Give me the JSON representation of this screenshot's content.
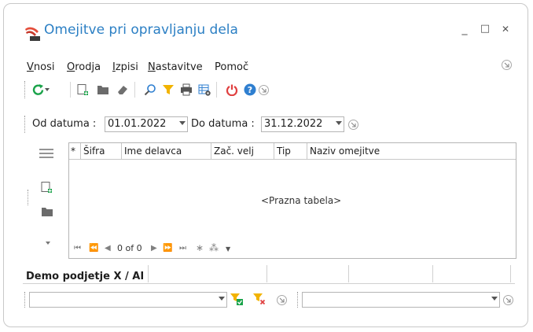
{
  "window": {
    "title": "Omejitve pri opravljanju dela",
    "controls": {
      "minimize": "_",
      "maximize": "□",
      "close": "✕"
    }
  },
  "menu": {
    "items": [
      {
        "label": "Vnosi",
        "accel": "V",
        "rest": "nosi"
      },
      {
        "label": "Orodja",
        "accel": "O",
        "rest": "rodja"
      },
      {
        "label": "Izpisi",
        "accel": "I",
        "rest": "zpisi"
      },
      {
        "label": "Nastavitve",
        "accel": "N",
        "rest": "astavitve"
      },
      {
        "label": "Pomoč",
        "accel": "",
        "rest": "Pomoč"
      }
    ]
  },
  "toolbar": {
    "icons": [
      "refresh-icon",
      "new-document-icon",
      "folder-icon",
      "eraser-icon",
      "search-icon",
      "filter-icon",
      "print-icon",
      "grid-settings-icon",
      "power-icon",
      "help-icon"
    ]
  },
  "date_filter": {
    "from_label": "Od datuma :",
    "from_value": "01.01.2022",
    "to_label": "Do datuma :",
    "to_value": "31.12.2022"
  },
  "table": {
    "columns": [
      "*",
      "Šifra",
      "Ime delavca",
      "Zač. velj",
      "Tip",
      "Naziv omejitve"
    ],
    "empty_text": "<Prazna tabela>",
    "navigator": {
      "first": "⏮",
      "prev_page": "⏪",
      "prev": "◀",
      "record_info": "0 of 0",
      "next": "▶",
      "next_page": "⏩",
      "last": "⏭",
      "insert": "∗",
      "insert_copy": "⁂",
      "filter": "▼"
    }
  },
  "company_tab": {
    "label": "Demo podjetje X / AI"
  },
  "bottom_filters": {
    "left_value": "",
    "right_value": ""
  },
  "colors": {
    "accent": "#2b7fc4",
    "refresh": "#1aa34a",
    "filter": "#f2b300",
    "power": "#e04040",
    "help": "#2f7fd0"
  }
}
